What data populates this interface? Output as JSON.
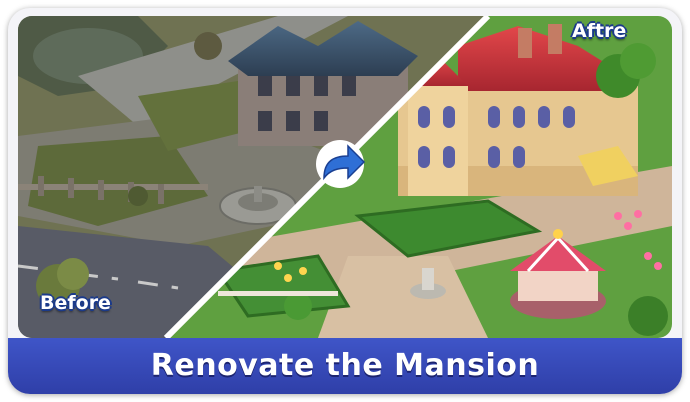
{
  "banner": {
    "title": "Renovate the Mansion"
  },
  "labels": {
    "before": "Before",
    "after": "Aftre"
  },
  "icons": {
    "arrow": "arrow-right-icon"
  },
  "colors": {
    "banner": "#3a4cc0",
    "arrow": "#2f6fd6",
    "divider": "#ffffff"
  }
}
